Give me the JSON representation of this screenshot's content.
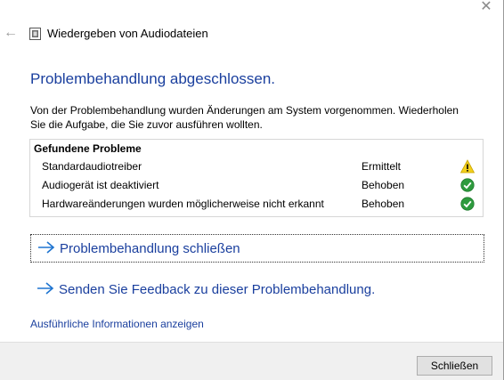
{
  "window": {
    "title": "Wiedergeben von Audiodateien",
    "close_glyph": "✕",
    "back_glyph": "←"
  },
  "heading": "Problembehandlung abgeschlossen.",
  "intro": "Von der Problembehandlung wurden Änderungen am System vorgenommen. Wiederholen Sie die Aufgabe, die Sie zuvor ausführen wollten.",
  "problems": {
    "header": "Gefundene Probleme",
    "rows": [
      {
        "name": "Standardaudiotreiber",
        "status": "Ermittelt",
        "icon": "warning-icon"
      },
      {
        "name": "Audiogerät ist deaktiviert",
        "status": "Behoben",
        "icon": "check-icon"
      },
      {
        "name": "Hardwareänderungen wurden möglicherweise nicht erkannt",
        "status": "Behoben",
        "icon": "check-icon"
      }
    ]
  },
  "links": {
    "close_troubleshooter": "Problembehandlung schließen",
    "send_feedback": "Senden Sie Feedback zu dieser Problembehandlung.",
    "details": "Ausführliche Informationen anzeigen"
  },
  "footer": {
    "close_button": "Schließen"
  },
  "colors": {
    "link_blue": "#1a3f9e",
    "arrow_blue": "#1e74d0",
    "warning_yellow": "#f2cf1c",
    "success_green": "#2e9b3e"
  }
}
